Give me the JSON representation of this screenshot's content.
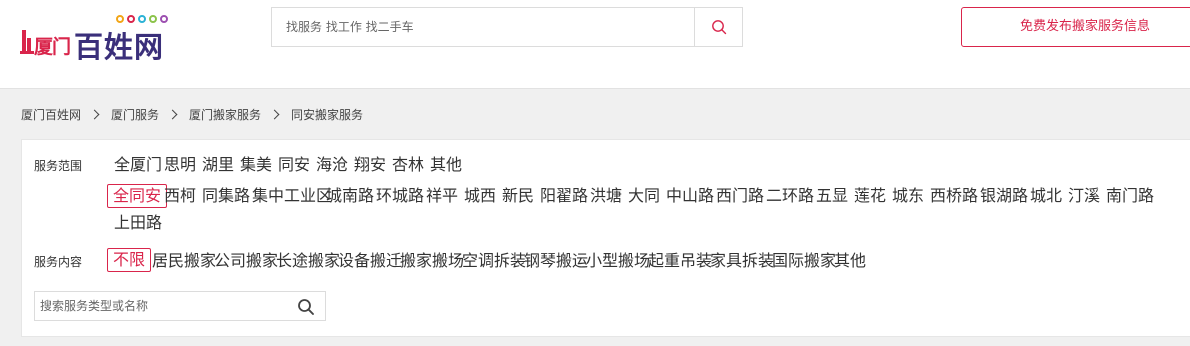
{
  "header": {
    "logo": {
      "city": "厦门",
      "brand": "百姓网",
      "dot_colors": [
        "#f2a516",
        "#d9254b",
        "#2bb2d6",
        "#8bc34a",
        "#9c4fb0"
      ]
    },
    "search": {
      "placeholder": "找服务 找工作 找二手车"
    },
    "publish_label": "免费发布搬家服务信息",
    "accent_color": "#d9254b"
  },
  "breadcrumb": [
    "厦门百姓网",
    "厦门服务",
    "厦门搬家服务",
    "同安搬家服务"
  ],
  "filters": {
    "area": {
      "label": "服务范围",
      "districts": [
        "全厦门",
        "思明",
        "湖里",
        "集美",
        "同安",
        "海沧",
        "翔安",
        "杏林",
        "其他"
      ],
      "sub_areas": [
        "全同安",
        "西柯",
        "同集路",
        "集中工业区",
        "城南路",
        "环城路",
        "祥平",
        "城西",
        "新民",
        "阳翟路",
        "洪塘",
        "大同",
        "中山路",
        "西门路",
        "二环路",
        "五显",
        "莲花",
        "城东",
        "西桥路",
        "银湖路",
        "城北",
        "汀溪",
        "南门路",
        "上田路"
      ],
      "active_sub_area": "全同安"
    },
    "content": {
      "label": "服务内容",
      "options": [
        "不限",
        "居民搬家",
        "公司搬家",
        "长途搬家",
        "设备搬迁",
        "搬家搬场",
        "空调拆装",
        "钢琴搬运",
        "小型搬场",
        "起重吊装",
        "家具拆装",
        "国际搬家",
        "其他"
      ],
      "active_option": "不限"
    },
    "search": {
      "placeholder": "搜索服务类型或名称"
    }
  }
}
